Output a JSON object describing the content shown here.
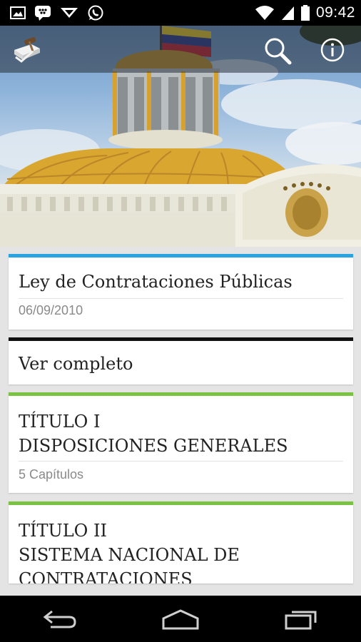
{
  "status_bar": {
    "time": "09:42",
    "notification_icons": [
      "image-icon",
      "bbm-icon",
      "download-icon",
      "whatsapp-icon"
    ],
    "system_icons": [
      "wifi-icon",
      "signal-icon",
      "battery-icon"
    ]
  },
  "toolbar": {
    "logo_icon": "gavel-document-logo-icon",
    "search_icon": "search-icon",
    "info_icon": "info-icon"
  },
  "cards": [
    {
      "accent_color": "#2aa4e0",
      "title": "Ley de Contrataciones Públicas",
      "subtitle": "06/09/2010"
    },
    {
      "accent_color": "#111111",
      "title": "Ver completo"
    },
    {
      "accent_color": "#7cc242",
      "title_line1": "TÍTULO I",
      "title_line2": "DISPOSICIONES GENERALES",
      "subtitle": "5 Capítulos"
    },
    {
      "accent_color": "#7cc242",
      "title_line1": "TÍTULO II",
      "title_line2": "SISTEMA NACIONAL DE",
      "title_line3": "CONTRATACIONES"
    }
  ],
  "nav": {
    "back_icon": "back-icon",
    "home_icon": "home-icon",
    "recents_icon": "recents-icon"
  }
}
